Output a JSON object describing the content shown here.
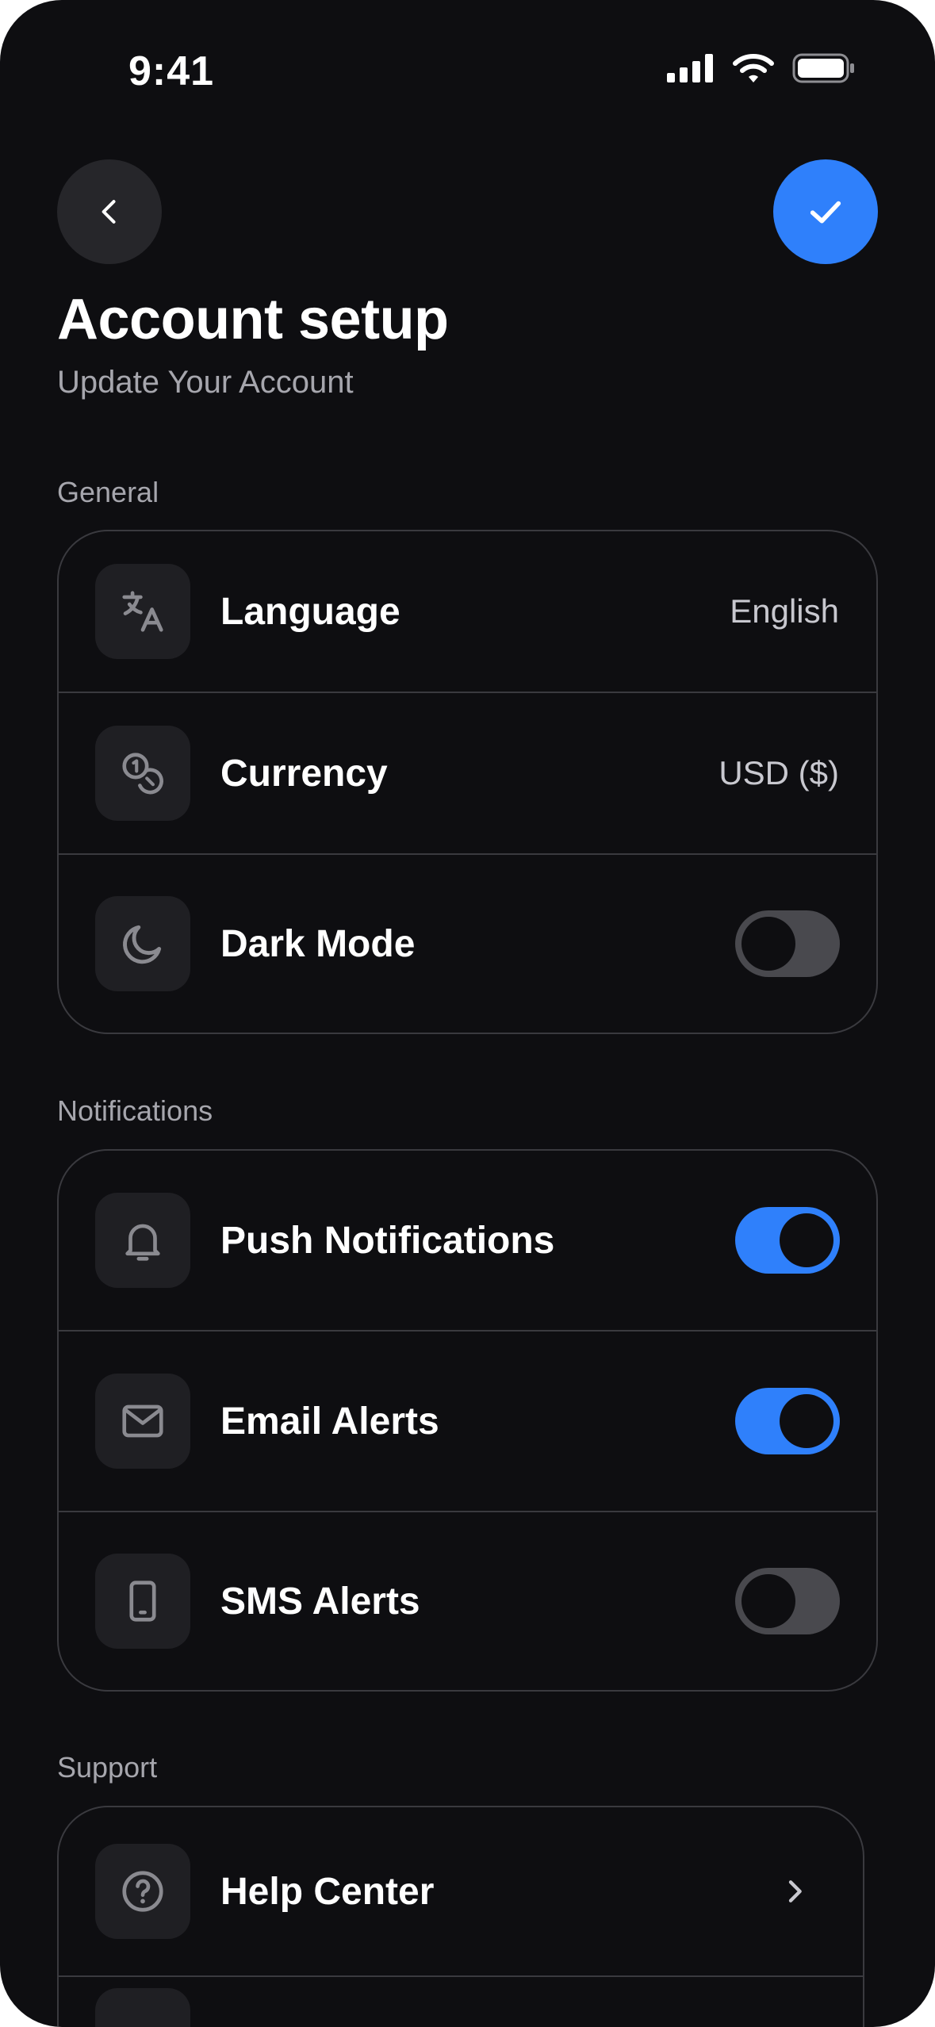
{
  "status_bar": {
    "time": "9:41"
  },
  "header": {
    "back_icon": "chevron-left-icon",
    "confirm_icon": "check-icon",
    "title": "Account setup",
    "subtitle": "Update Your Account"
  },
  "colors": {
    "background": "#0e0e11",
    "accent": "#2f80fb",
    "card_border": "#3a3a3f",
    "toggle_off": "#49494e"
  },
  "sections": {
    "general": {
      "label": "General",
      "items": [
        {
          "label": "Language",
          "value": "English",
          "icon": "translate-icon"
        },
        {
          "label": "Currency",
          "value": "USD ($)",
          "icon": "coins-icon"
        },
        {
          "label": "Dark Mode",
          "toggle": false,
          "icon": "moon-icon"
        }
      ]
    },
    "notifications": {
      "label": "Notifications",
      "items": [
        {
          "label": "Push Notifications",
          "toggle": true,
          "icon": "bell-icon"
        },
        {
          "label": "Email Alerts",
          "toggle": true,
          "icon": "mail-icon"
        },
        {
          "label": "SMS Alerts",
          "toggle": false,
          "icon": "smartphone-icon"
        }
      ]
    },
    "support": {
      "label": "Support",
      "items": [
        {
          "label": "Help Center",
          "icon": "help-circle-icon"
        }
      ]
    }
  }
}
